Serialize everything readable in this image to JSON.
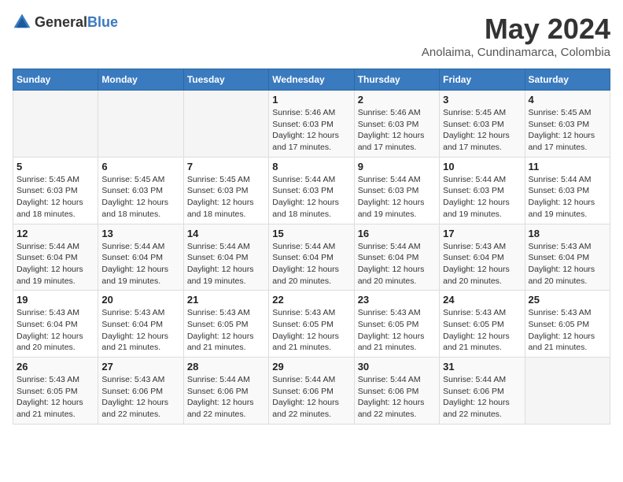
{
  "logo": {
    "text_general": "General",
    "text_blue": "Blue"
  },
  "header": {
    "title": "May 2024",
    "subtitle": "Anolaima, Cundinamarca, Colombia"
  },
  "days_of_week": [
    "Sunday",
    "Monday",
    "Tuesday",
    "Wednesday",
    "Thursday",
    "Friday",
    "Saturday"
  ],
  "weeks": [
    {
      "days": [
        {
          "number": "",
          "info": "",
          "empty": true
        },
        {
          "number": "",
          "info": "",
          "empty": true
        },
        {
          "number": "",
          "info": "",
          "empty": true
        },
        {
          "number": "1",
          "info": "Sunrise: 5:46 AM\nSunset: 6:03 PM\nDaylight: 12 hours\nand 17 minutes.",
          "empty": false
        },
        {
          "number": "2",
          "info": "Sunrise: 5:46 AM\nSunset: 6:03 PM\nDaylight: 12 hours\nand 17 minutes.",
          "empty": false
        },
        {
          "number": "3",
          "info": "Sunrise: 5:45 AM\nSunset: 6:03 PM\nDaylight: 12 hours\nand 17 minutes.",
          "empty": false
        },
        {
          "number": "4",
          "info": "Sunrise: 5:45 AM\nSunset: 6:03 PM\nDaylight: 12 hours\nand 17 minutes.",
          "empty": false
        }
      ]
    },
    {
      "days": [
        {
          "number": "5",
          "info": "Sunrise: 5:45 AM\nSunset: 6:03 PM\nDaylight: 12 hours\nand 18 minutes.",
          "empty": false
        },
        {
          "number": "6",
          "info": "Sunrise: 5:45 AM\nSunset: 6:03 PM\nDaylight: 12 hours\nand 18 minutes.",
          "empty": false
        },
        {
          "number": "7",
          "info": "Sunrise: 5:45 AM\nSunset: 6:03 PM\nDaylight: 12 hours\nand 18 minutes.",
          "empty": false
        },
        {
          "number": "8",
          "info": "Sunrise: 5:44 AM\nSunset: 6:03 PM\nDaylight: 12 hours\nand 18 minutes.",
          "empty": false
        },
        {
          "number": "9",
          "info": "Sunrise: 5:44 AM\nSunset: 6:03 PM\nDaylight: 12 hours\nand 19 minutes.",
          "empty": false
        },
        {
          "number": "10",
          "info": "Sunrise: 5:44 AM\nSunset: 6:03 PM\nDaylight: 12 hours\nand 19 minutes.",
          "empty": false
        },
        {
          "number": "11",
          "info": "Sunrise: 5:44 AM\nSunset: 6:03 PM\nDaylight: 12 hours\nand 19 minutes.",
          "empty": false
        }
      ]
    },
    {
      "days": [
        {
          "number": "12",
          "info": "Sunrise: 5:44 AM\nSunset: 6:04 PM\nDaylight: 12 hours\nand 19 minutes.",
          "empty": false
        },
        {
          "number": "13",
          "info": "Sunrise: 5:44 AM\nSunset: 6:04 PM\nDaylight: 12 hours\nand 19 minutes.",
          "empty": false
        },
        {
          "number": "14",
          "info": "Sunrise: 5:44 AM\nSunset: 6:04 PM\nDaylight: 12 hours\nand 19 minutes.",
          "empty": false
        },
        {
          "number": "15",
          "info": "Sunrise: 5:44 AM\nSunset: 6:04 PM\nDaylight: 12 hours\nand 20 minutes.",
          "empty": false
        },
        {
          "number": "16",
          "info": "Sunrise: 5:44 AM\nSunset: 6:04 PM\nDaylight: 12 hours\nand 20 minutes.",
          "empty": false
        },
        {
          "number": "17",
          "info": "Sunrise: 5:43 AM\nSunset: 6:04 PM\nDaylight: 12 hours\nand 20 minutes.",
          "empty": false
        },
        {
          "number": "18",
          "info": "Sunrise: 5:43 AM\nSunset: 6:04 PM\nDaylight: 12 hours\nand 20 minutes.",
          "empty": false
        }
      ]
    },
    {
      "days": [
        {
          "number": "19",
          "info": "Sunrise: 5:43 AM\nSunset: 6:04 PM\nDaylight: 12 hours\nand 20 minutes.",
          "empty": false
        },
        {
          "number": "20",
          "info": "Sunrise: 5:43 AM\nSunset: 6:04 PM\nDaylight: 12 hours\nand 21 minutes.",
          "empty": false
        },
        {
          "number": "21",
          "info": "Sunrise: 5:43 AM\nSunset: 6:05 PM\nDaylight: 12 hours\nand 21 minutes.",
          "empty": false
        },
        {
          "number": "22",
          "info": "Sunrise: 5:43 AM\nSunset: 6:05 PM\nDaylight: 12 hours\nand 21 minutes.",
          "empty": false
        },
        {
          "number": "23",
          "info": "Sunrise: 5:43 AM\nSunset: 6:05 PM\nDaylight: 12 hours\nand 21 minutes.",
          "empty": false
        },
        {
          "number": "24",
          "info": "Sunrise: 5:43 AM\nSunset: 6:05 PM\nDaylight: 12 hours\nand 21 minutes.",
          "empty": false
        },
        {
          "number": "25",
          "info": "Sunrise: 5:43 AM\nSunset: 6:05 PM\nDaylight: 12 hours\nand 21 minutes.",
          "empty": false
        }
      ]
    },
    {
      "days": [
        {
          "number": "26",
          "info": "Sunrise: 5:43 AM\nSunset: 6:05 PM\nDaylight: 12 hours\nand 21 minutes.",
          "empty": false
        },
        {
          "number": "27",
          "info": "Sunrise: 5:43 AM\nSunset: 6:06 PM\nDaylight: 12 hours\nand 22 minutes.",
          "empty": false
        },
        {
          "number": "28",
          "info": "Sunrise: 5:44 AM\nSunset: 6:06 PM\nDaylight: 12 hours\nand 22 minutes.",
          "empty": false
        },
        {
          "number": "29",
          "info": "Sunrise: 5:44 AM\nSunset: 6:06 PM\nDaylight: 12 hours\nand 22 minutes.",
          "empty": false
        },
        {
          "number": "30",
          "info": "Sunrise: 5:44 AM\nSunset: 6:06 PM\nDaylight: 12 hours\nand 22 minutes.",
          "empty": false
        },
        {
          "number": "31",
          "info": "Sunrise: 5:44 AM\nSunset: 6:06 PM\nDaylight: 12 hours\nand 22 minutes.",
          "empty": false
        },
        {
          "number": "",
          "info": "",
          "empty": true
        }
      ]
    }
  ]
}
